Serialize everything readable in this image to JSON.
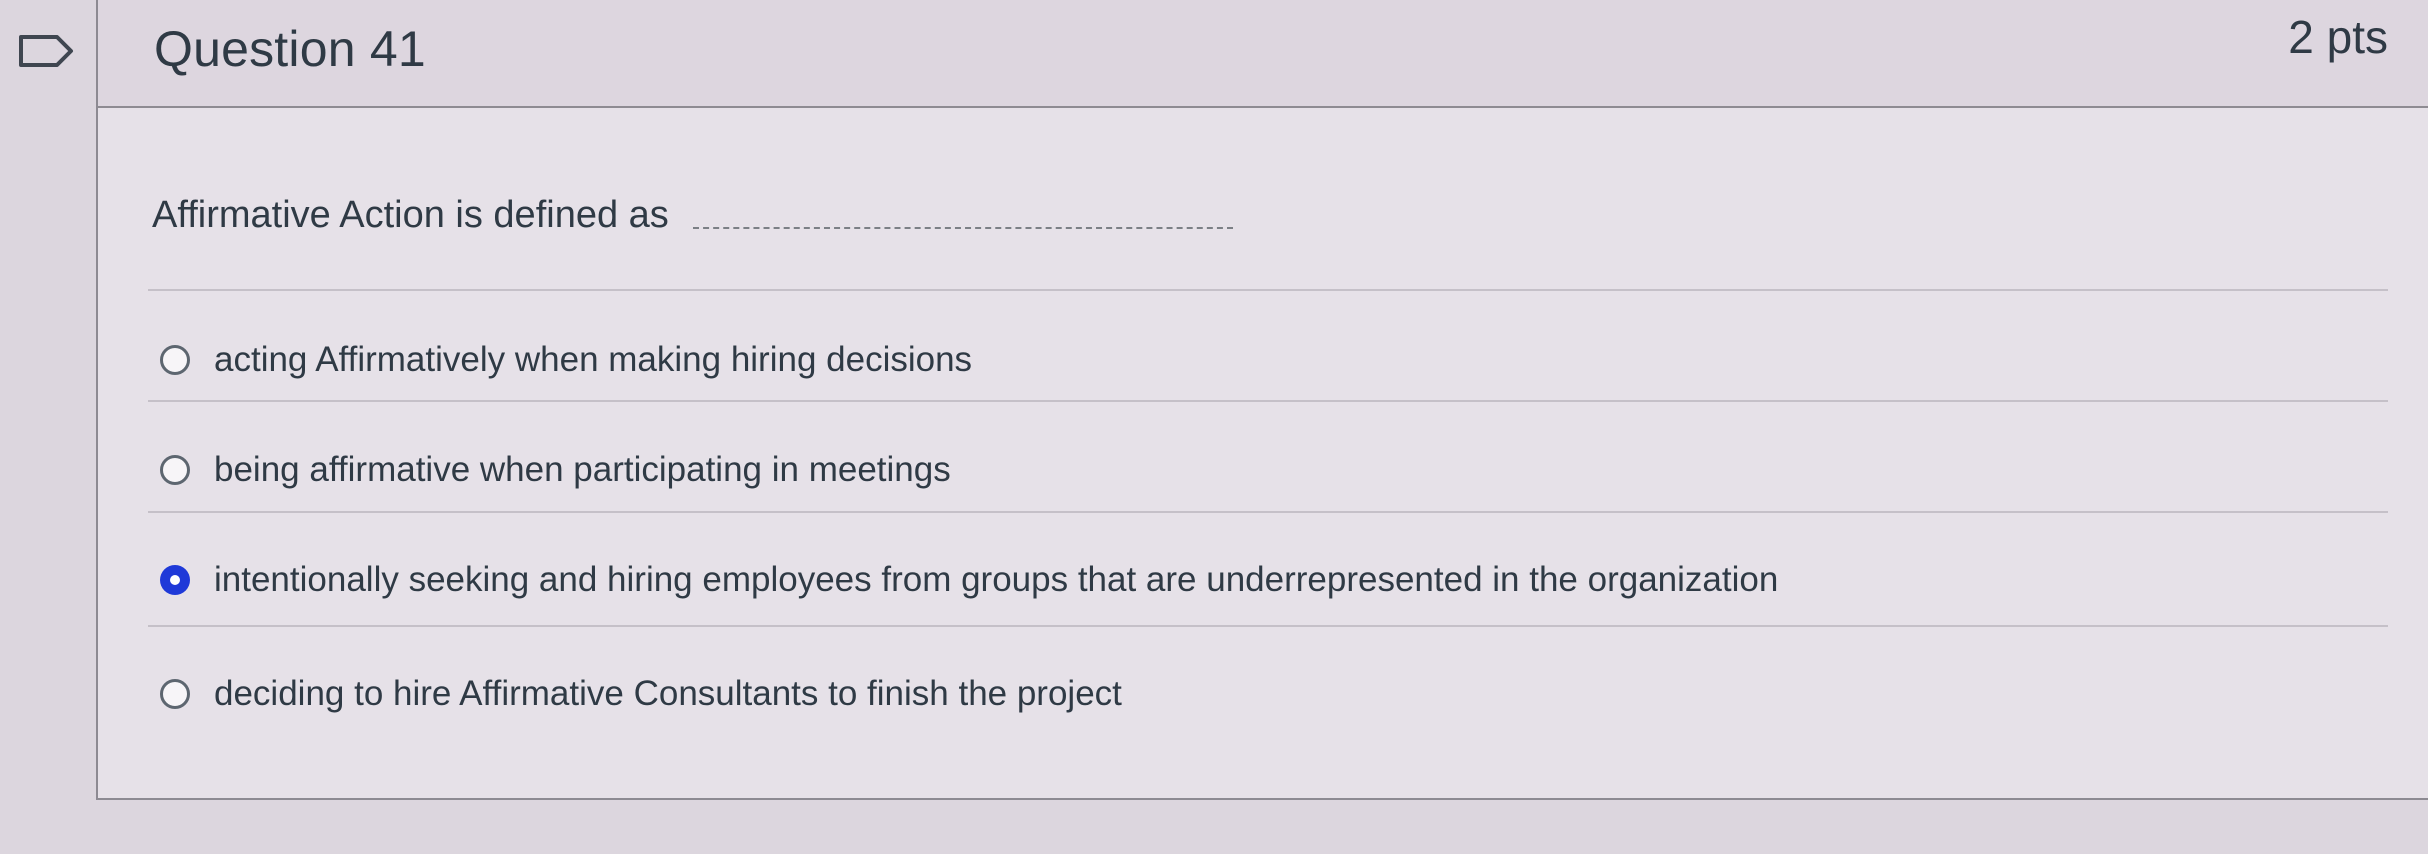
{
  "question": {
    "title": "Question 41",
    "points": "2 pts",
    "prompt": "Affirmative Action is defined as",
    "answers": [
      {
        "label": "acting Affirmatively when making hiring decisions",
        "selected": false
      },
      {
        "label": "being affirmative when participating in meetings",
        "selected": false
      },
      {
        "label": "intentionally seeking and hiring employees from groups that are underrepresented in the organization",
        "selected": true
      },
      {
        "label": "deciding to hire Affirmative Consultants to finish the project",
        "selected": false
      }
    ]
  },
  "icons": {
    "flag": "flag-icon",
    "radio": "radio-button-icon"
  },
  "colors": {
    "page_background": "#dcd6de",
    "card_background": "#e6e1e8",
    "text": "#2f3a45",
    "selected_radio": "#1f39d8",
    "border": "#8e8b92"
  }
}
